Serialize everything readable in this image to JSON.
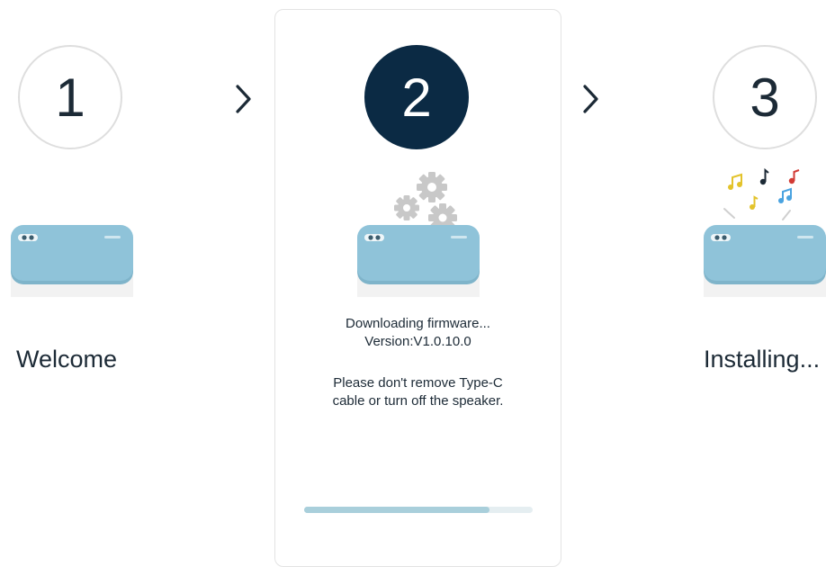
{
  "steps": [
    {
      "number": "1",
      "label": "Welcome",
      "state": "done"
    },
    {
      "number": "2",
      "state": "active"
    },
    {
      "number": "3",
      "label": "Installing...",
      "state": "pending"
    }
  ],
  "download": {
    "title": "Downloading firmware...",
    "version": "Version:V1.0.10.0",
    "warning_line1": "Please don't remove Type-C",
    "warning_line2": "cable or turn off the speaker.",
    "progress": 0.81
  },
  "icons": {
    "separator": "chevron-right-icon",
    "device": "speaker-icon",
    "gears": "gears-icon",
    "notes": "music-notes-icon"
  },
  "colors": {
    "active_step": "#0b2a44",
    "speaker": "#8fc3d9",
    "progress_fill": "#a9cfdb",
    "progress_track": "#e5eef1"
  }
}
